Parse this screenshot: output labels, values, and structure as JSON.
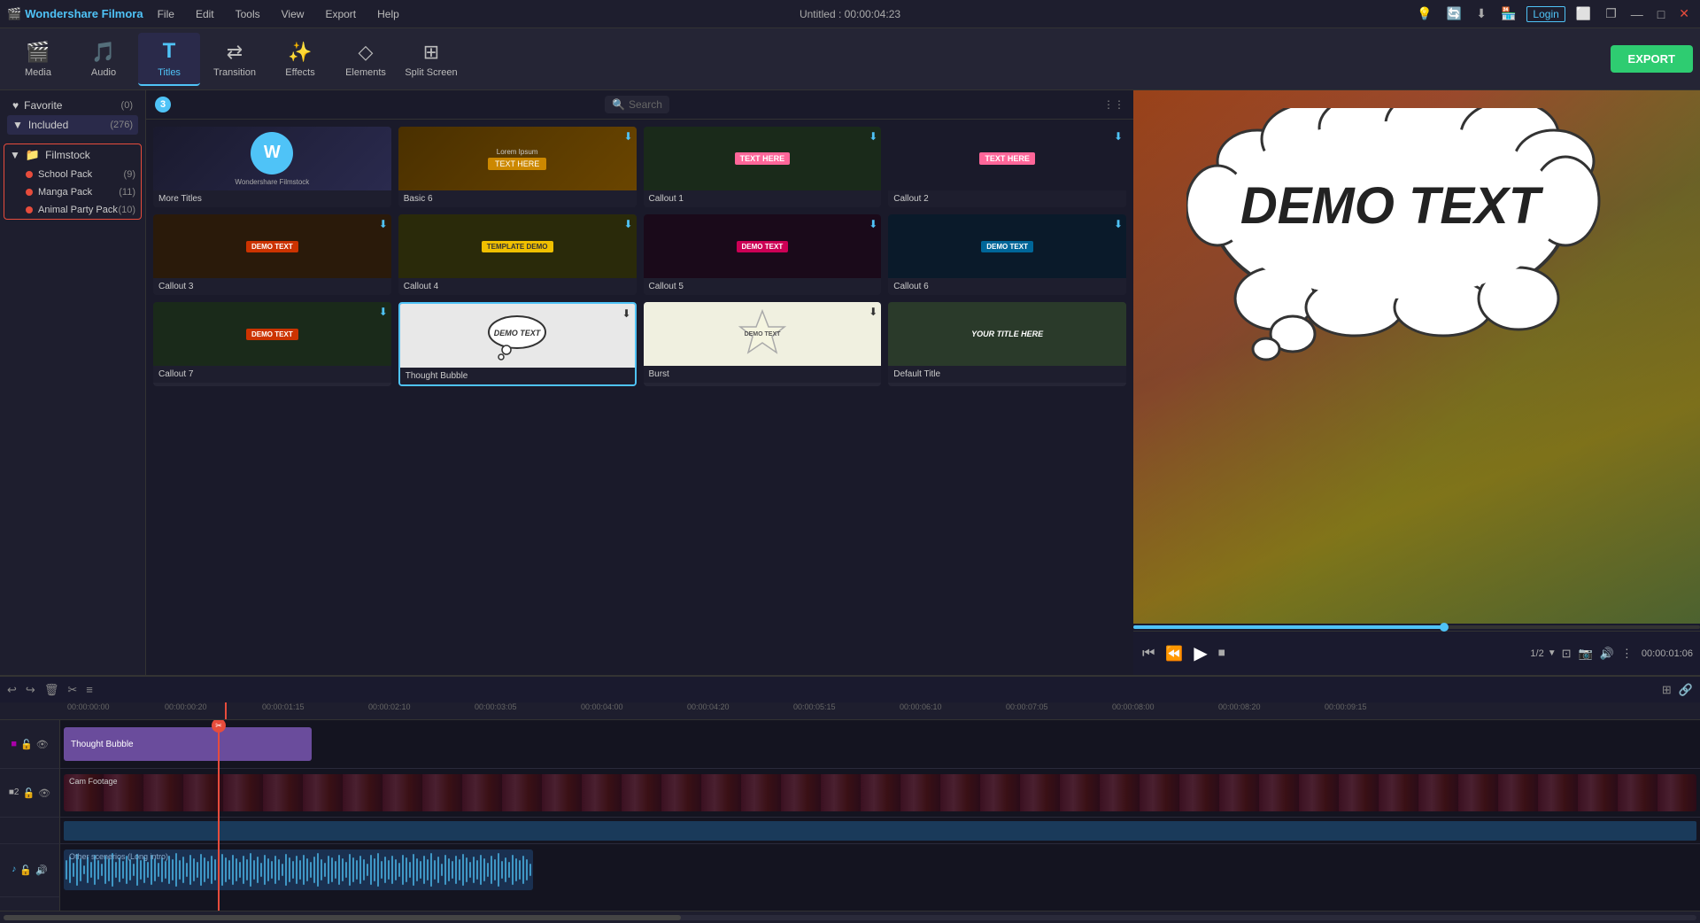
{
  "app": {
    "title": "Untitled : 00:00:04:23",
    "name": "Wondershare Filmora"
  },
  "titlebar": {
    "menus": [
      "File",
      "Edit",
      "Tools",
      "View",
      "Export",
      "Help"
    ],
    "login_label": "Login"
  },
  "toolbar": {
    "items": [
      {
        "id": "media",
        "label": "Media",
        "icon": "🎬"
      },
      {
        "id": "audio",
        "label": "Audio",
        "icon": "🎵"
      },
      {
        "id": "titles",
        "label": "Titles",
        "icon": "T"
      },
      {
        "id": "transition",
        "label": "Transition",
        "icon": "⇄"
      },
      {
        "id": "effects",
        "label": "Effects",
        "icon": "✨"
      },
      {
        "id": "elements",
        "label": "Elements",
        "icon": "◇"
      },
      {
        "id": "split_screen",
        "label": "Split Screen",
        "icon": "⊞"
      }
    ],
    "active": "titles",
    "export_label": "EXPORT"
  },
  "left_panel": {
    "favorite": {
      "label": "Favorite",
      "count": "(0)"
    },
    "included": {
      "label": "Included",
      "count": "(276)"
    },
    "filmstock": {
      "label": "Filmstock"
    },
    "packs": [
      {
        "name": "School Pack",
        "count": "(9)"
      },
      {
        "name": "Manga Pack",
        "count": "(11)"
      },
      {
        "name": "Animal Party Pack",
        "count": "(10)"
      }
    ]
  },
  "content_panel": {
    "number": "3",
    "search_placeholder": "Search",
    "cards": [
      {
        "id": "filmstock",
        "label": "More Titles",
        "type": "filmstock"
      },
      {
        "id": "basic",
        "label": "Basic 6",
        "type": "basic"
      },
      {
        "id": "callout1",
        "label": "Callout 1",
        "type": "callout1"
      },
      {
        "id": "callout2",
        "label": "Callout 2",
        "type": "callout2"
      },
      {
        "id": "callout3",
        "label": "Callout 3",
        "type": "callout3"
      },
      {
        "id": "callout4",
        "label": "Callout 4",
        "type": "callout4"
      },
      {
        "id": "callout5",
        "label": "Callout 5",
        "type": "callout5"
      },
      {
        "id": "callout6",
        "label": "Callout 6",
        "type": "callout6"
      },
      {
        "id": "callout7",
        "label": "Callout 7",
        "type": "callout7"
      },
      {
        "id": "thought_bubble",
        "label": "Thought Bubble",
        "type": "thought",
        "selected": true
      },
      {
        "id": "burst",
        "label": "Burst",
        "type": "burst"
      },
      {
        "id": "default_title",
        "label": "Default Title",
        "type": "default"
      }
    ]
  },
  "preview": {
    "demo_text": "DEMO TEXT",
    "time_current": "00:00:01:06",
    "fraction": "1/2",
    "progress_pct": 55
  },
  "timeline": {
    "timestamps": [
      "00:00:00:00",
      "00:00:00:20",
      "00:00:01:15",
      "00:00:02:10",
      "00:00:03:05",
      "00:00:04:00",
      "00:00:04:20",
      "00:00:05:15",
      "00:00:06:10",
      "00:00:07:05",
      "00:00:08:00",
      "00:00:08:20",
      "00:00:09:15"
    ],
    "tracks": [
      {
        "type": "title",
        "label": "Thought Bubble"
      },
      {
        "type": "video",
        "label": "Cam Footage"
      },
      {
        "type": "video2",
        "label": ""
      },
      {
        "type": "audio",
        "label": "Other scenerios (Long intro)"
      }
    ]
  }
}
